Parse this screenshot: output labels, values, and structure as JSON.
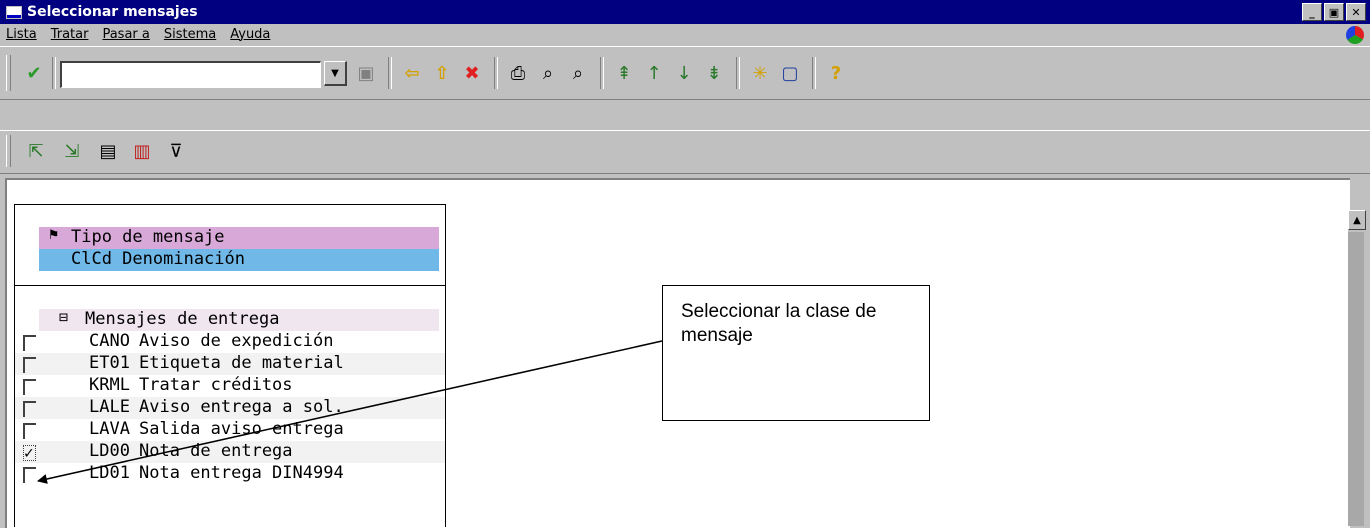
{
  "window": {
    "title": "Seleccionar mensajes",
    "buttons": [
      "_",
      "▣",
      "✕"
    ]
  },
  "menu": {
    "items": [
      "Lista",
      "Tratar",
      "Pasar a",
      "Sistema",
      "Ayuda"
    ]
  },
  "toolbar": {
    "command_value": ""
  },
  "panel": {
    "header_label": "Tipo de mensaje",
    "header_columns": "ClCd Denominación",
    "group_label": "Mensajes de entrega",
    "rows": [
      {
        "code": "CANO",
        "text": "Aviso de expedición",
        "checked": false
      },
      {
        "code": "ET01",
        "text": "Etiqueta de material",
        "checked": false
      },
      {
        "code": "KRML",
        "text": "Tratar créditos",
        "checked": false
      },
      {
        "code": "LALE",
        "text": "Aviso entrega a sol.",
        "checked": false
      },
      {
        "code": "LAVA",
        "text": "Salida aviso entrega",
        "checked": false
      },
      {
        "code": "LD00",
        "text": "Nota de entrega",
        "checked": true
      },
      {
        "code": "LD01",
        "text": "Nota entrega DIN4994",
        "checked": false
      }
    ]
  },
  "callout": {
    "text": "Seleccionar la clase de mensaje"
  }
}
